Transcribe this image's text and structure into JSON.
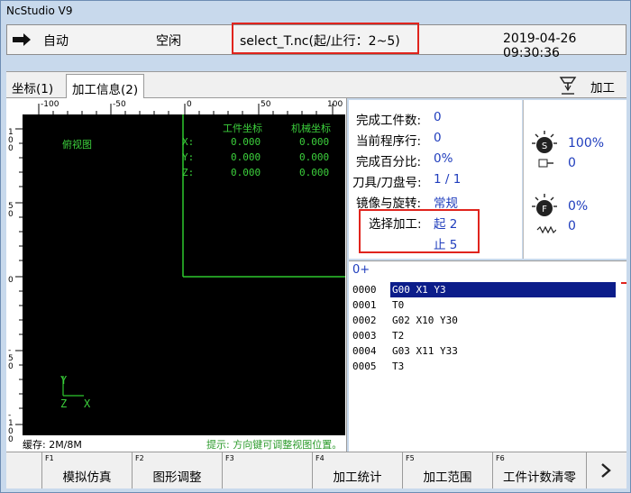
{
  "window": {
    "title": "NcStudio V9"
  },
  "status": {
    "mode": "自动",
    "state": "空闲",
    "file": "select_T.nc(起/止行：2~5)",
    "datetime": "2019-04-26 09:30:36"
  },
  "tabs": [
    {
      "label": "坐标(1)",
      "active": false
    },
    {
      "label": "加工信息(2)",
      "active": true
    }
  ],
  "right_action": {
    "label": "加工",
    "icon": "machine-icon"
  },
  "ruler_top": [
    "-100",
    "-50",
    "0",
    "50",
    "100"
  ],
  "ruler_left": [
    "1 0 0",
    "5 0",
    "0",
    "-5 0",
    "-1 0 0"
  ],
  "view": {
    "label": "俯视图",
    "coord_header_work": "工件坐标",
    "coord_header_machine": "机械坐标",
    "coords": [
      {
        "axis": "X:",
        "work": "0.000",
        "machine": "0.000"
      },
      {
        "axis": "Y:",
        "work": "0.000",
        "machine": "0.000"
      },
      {
        "axis": "Z:",
        "work": "0.000",
        "machine": "0.000"
      }
    ],
    "axis_y": "Y",
    "axis_z": "Z",
    "axis_x": "X"
  },
  "leftfooter": {
    "cache": "缓存: 2M/8M",
    "hint": "提示: 方向键可调整视图位置。"
  },
  "info": {
    "done_count_label": "完成工件数:",
    "done_count": "0",
    "current_line_label": "当前程序行:",
    "current_line": "0",
    "percent_label": "完成百分比:",
    "percent": "0%",
    "tool_label": "刀具/刀盘号:",
    "tool": "1 / 1",
    "mirror_label": "镜像与旋转:",
    "mirror": "常规",
    "select_label": "选择加工:",
    "select_start": "起 2",
    "select_end": "止 5"
  },
  "spindle": {
    "s_icon": "S",
    "s_percent": "100%",
    "s_value": "0",
    "f_icon": "F",
    "f_percent": "0%",
    "f_value": "0"
  },
  "gcode": {
    "header": "0+",
    "lines": [
      {
        "num": "0000",
        "code": "G00 X1 Y3"
      },
      {
        "num": "0001",
        "code": "T0"
      },
      {
        "num": "0002",
        "code": "G02 X10 Y30"
      },
      {
        "num": "0003",
        "code": "T2"
      },
      {
        "num": "0004",
        "code": "G03 X11 Y33"
      },
      {
        "num": "0005",
        "code": "T3"
      }
    ]
  },
  "fkeys": [
    {
      "num": "F1",
      "label": "模拟仿真"
    },
    {
      "num": "F2",
      "label": "图形调整"
    },
    {
      "num": "F3",
      "label": ""
    },
    {
      "num": "F4",
      "label": "加工统计"
    },
    {
      "num": "F5",
      "label": "加工范围"
    },
    {
      "num": "F6",
      "label": "工件计数清零"
    }
  ],
  "more_icon": "chevron-right-icon"
}
